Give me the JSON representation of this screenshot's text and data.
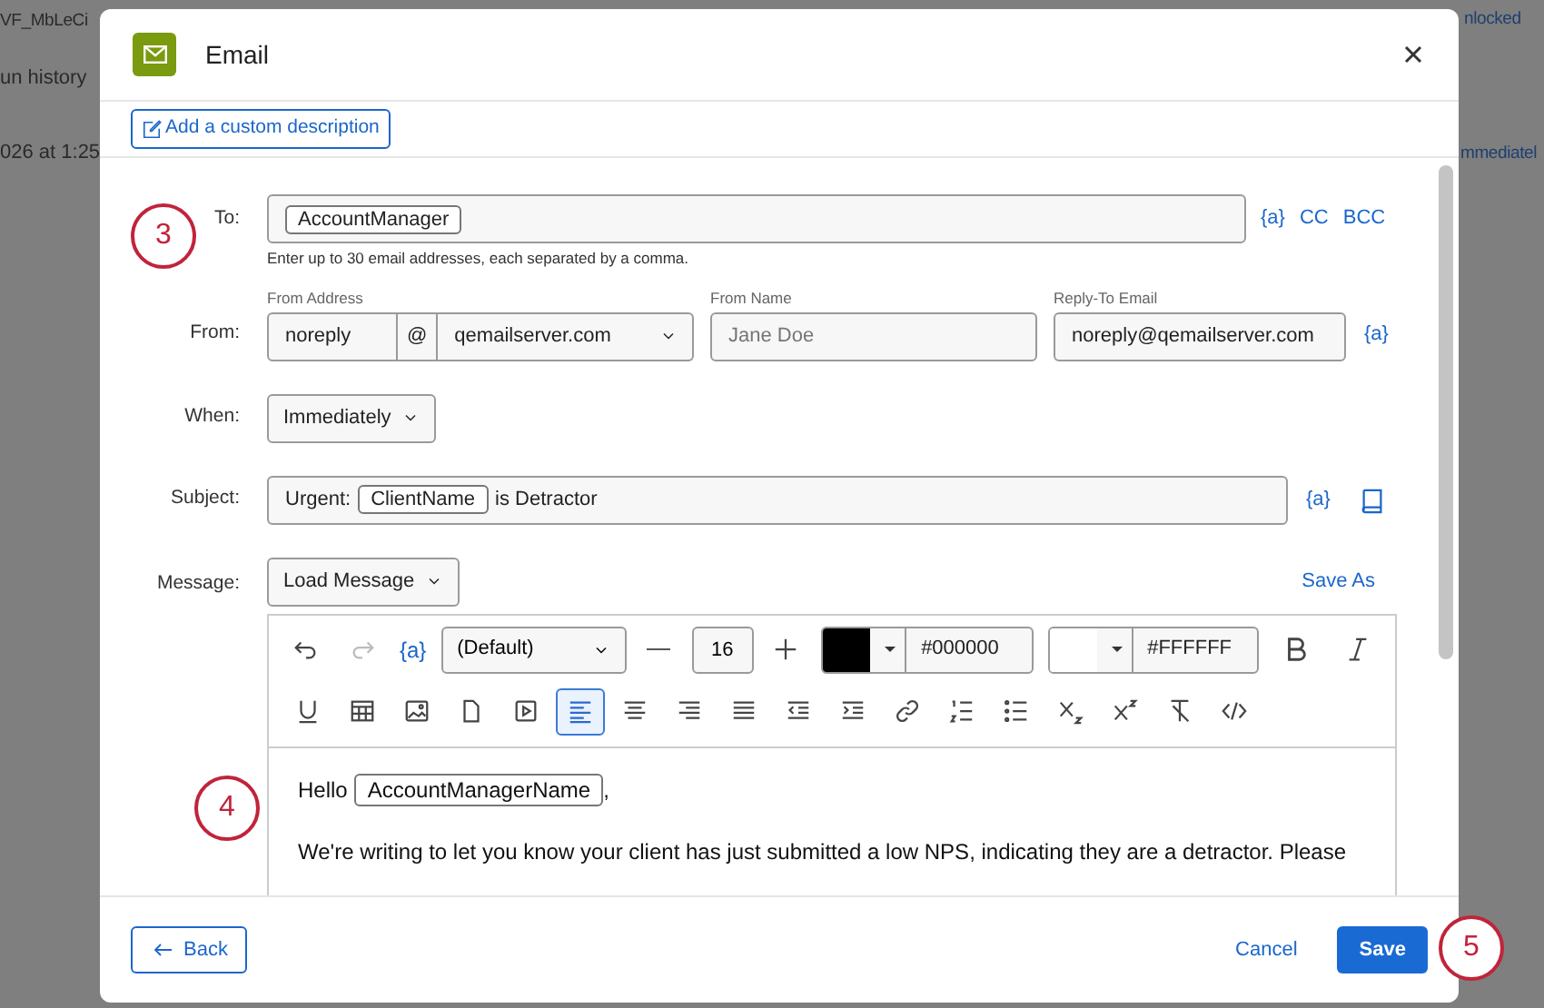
{
  "background": {
    "title": "VF_MbLeCi",
    "tab": "un history",
    "date": "026 at 1:25",
    "lock_label": "nlocked",
    "when_value": "mmediatel"
  },
  "dialog": {
    "title": "Email",
    "description_button": "Add a custom description",
    "to": {
      "label": "To:",
      "chips": [
        "AccountManager"
      ],
      "hint": "Enter up to 30 email addresses, each separated by a comma.",
      "actions": [
        "{a}",
        "CC",
        "BCC"
      ]
    },
    "from": {
      "label": "From:",
      "address_label": "From Address",
      "local": "noreply",
      "at": "@",
      "domain": "qemailserver.com",
      "name_label": "From Name",
      "name_placeholder": "Jane Doe",
      "reply_label": "Reply-To Email",
      "reply_value": "noreply@qemailserver.com",
      "action": "{a}"
    },
    "when": {
      "label": "When:",
      "value": "Immediately"
    },
    "subject": {
      "label": "Subject:",
      "parts": [
        {
          "kind": "text",
          "text": "Urgent:"
        },
        {
          "kind": "chip",
          "text": "ClientName"
        },
        {
          "kind": "text",
          "text": "is Detractor"
        }
      ],
      "action": "{a}"
    },
    "message": {
      "label": "Message:",
      "load_button": "Load Message",
      "save_as": "Save As"
    },
    "toolbar": {
      "history": [
        {
          "kind": "undo",
          "disabled": false
        },
        {
          "kind": "redo",
          "disabled": true
        }
      ],
      "piped": "{a}",
      "font": "(Default)",
      "size": "16",
      "colors": [
        {
          "color": "#000000",
          "value": "#000000"
        },
        {
          "color": "#ffffff",
          "value": "#FFFFFF"
        }
      ],
      "row1_tools": [
        {
          "kind": "bold",
          "selected": false
        },
        {
          "kind": "italic",
          "selected": false
        }
      ],
      "row2_tools": [
        {
          "kind": "underline",
          "selected": false
        },
        {
          "kind": "table",
          "selected": false
        },
        {
          "kind": "image",
          "selected": false
        },
        {
          "kind": "file",
          "selected": false
        },
        {
          "kind": "video",
          "selected": false
        },
        {
          "kind": "align-left",
          "selected": true
        },
        {
          "kind": "align-center",
          "selected": false
        },
        {
          "kind": "align-right",
          "selected": false
        },
        {
          "kind": "justify",
          "selected": false
        },
        {
          "kind": "outdent",
          "selected": false
        },
        {
          "kind": "indent",
          "selected": false
        },
        {
          "kind": "link",
          "selected": false
        },
        {
          "kind": "ordered-list",
          "selected": false
        },
        {
          "kind": "bullet-list",
          "selected": false
        },
        {
          "kind": "subscript",
          "selected": false
        },
        {
          "kind": "superscript",
          "selected": false
        },
        {
          "kind": "clear-format",
          "selected": false
        },
        {
          "kind": "code",
          "selected": false
        }
      ]
    },
    "body": [
      {
        "parts": [
          {
            "kind": "text",
            "text": "Hello"
          },
          {
            "kind": "chip",
            "text": "AccountManagerName"
          },
          {
            "kind": "text",
            "text": ","
          }
        ]
      },
      {
        "parts": [
          {
            "kind": "text",
            "text": "We're writing to let you know your client has just submitted a low NPS, indicating they are a detractor. Please"
          }
        ]
      }
    ],
    "footer": {
      "back": "Back",
      "cancel": "Cancel",
      "save": "Save"
    }
  },
  "annotations": [
    "3",
    "4",
    "5"
  ]
}
